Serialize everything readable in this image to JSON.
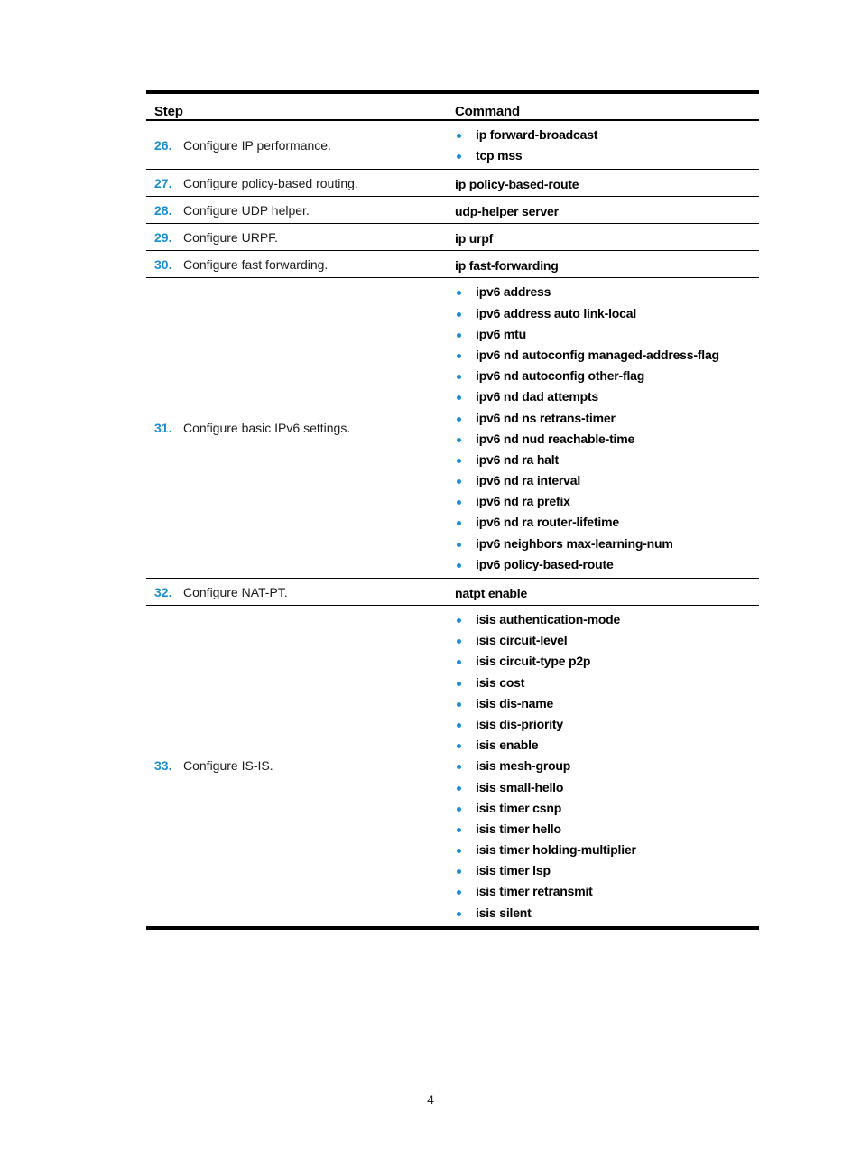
{
  "table": {
    "headers": {
      "step": "Step",
      "command": "Command"
    },
    "rows": [
      {
        "num": "26.",
        "desc": "Configure IP performance.",
        "commands": [
          "ip forward-broadcast",
          "tcp mss"
        ]
      },
      {
        "num": "27.",
        "desc": "Configure policy-based routing.",
        "command": "ip policy-based-route"
      },
      {
        "num": "28.",
        "desc": "Configure UDP helper.",
        "command": "udp-helper server"
      },
      {
        "num": "29.",
        "desc": "Configure URPF.",
        "command": "ip urpf"
      },
      {
        "num": "30.",
        "desc": "Configure fast forwarding.",
        "command": "ip fast-forwarding"
      },
      {
        "num": "31.",
        "desc": "Configure basic IPv6 settings.",
        "commands": [
          "ipv6 address",
          "ipv6 address auto link-local",
          "ipv6 mtu",
          "ipv6 nd autoconfig managed-address-flag",
          "ipv6 nd autoconfig other-flag",
          "ipv6 nd dad attempts",
          "ipv6 nd ns retrans-timer",
          "ipv6 nd nud reachable-time",
          "ipv6 nd ra halt",
          "ipv6 nd ra interval",
          "ipv6 nd ra prefix",
          "ipv6 nd ra router-lifetime",
          "ipv6 neighbors max-learning-num",
          "ipv6 policy-based-route"
        ]
      },
      {
        "num": "32.",
        "desc": "Configure NAT-PT.",
        "command": "natpt enable"
      },
      {
        "num": "33.",
        "desc": "Configure IS-IS.",
        "commands": [
          "isis authentication-mode",
          "isis circuit-level",
          "isis circuit-type p2p",
          "isis cost",
          "isis dis-name",
          "isis dis-priority",
          "isis enable",
          "isis mesh-group",
          "isis small-hello",
          "isis timer csnp",
          "isis timer hello",
          "isis timer holding-multiplier",
          "isis timer lsp",
          "isis timer retransmit",
          "isis silent"
        ]
      }
    ]
  },
  "colors": {
    "accent": "#1c8fd0"
  },
  "footer": {
    "page_number": "4"
  }
}
